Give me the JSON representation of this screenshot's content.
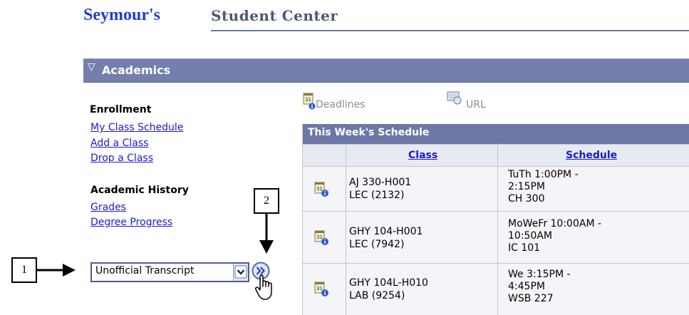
{
  "header": {
    "brand": "Seymour's",
    "title": "Student Center"
  },
  "section": {
    "title": "Academics"
  },
  "enrollment": {
    "heading": "Enrollment",
    "links": [
      "My Class Schedule",
      "Add a Class",
      "Drop a Class"
    ]
  },
  "history": {
    "heading": "Academic History",
    "links": [
      "Grades",
      "Degree Progress"
    ]
  },
  "other_select": {
    "value": "Unofficial Transcript"
  },
  "tools": {
    "deadlines": "Deadlines",
    "url": "URL"
  },
  "schedule": {
    "title": "This Week's Schedule",
    "columns": [
      "Class",
      "Schedule"
    ],
    "rows": [
      {
        "class_line1": "AJ 330-H001",
        "class_line2": "LEC (2132)",
        "sched_line1": "TuTh 1:00PM -",
        "sched_line2": "2:15PM",
        "sched_line3": "CH 300"
      },
      {
        "class_line1": "GHY 104-H001",
        "class_line2": "LEC (7942)",
        "sched_line1": "MoWeFr 10:00AM -",
        "sched_line2": "10:50AM",
        "sched_line3": "IC 101"
      },
      {
        "class_line1": "GHY 104L-H010",
        "class_line2": "LAB (9254)",
        "sched_line1": "We 3:15PM -",
        "sched_line2": "4:45PM",
        "sched_line3": "WSB 227"
      }
    ]
  },
  "callouts": [
    "1",
    "2"
  ],
  "colors": {
    "brand": "#1f3fd0",
    "section_bar": "#7380ad",
    "link": "#1a1ad2"
  }
}
